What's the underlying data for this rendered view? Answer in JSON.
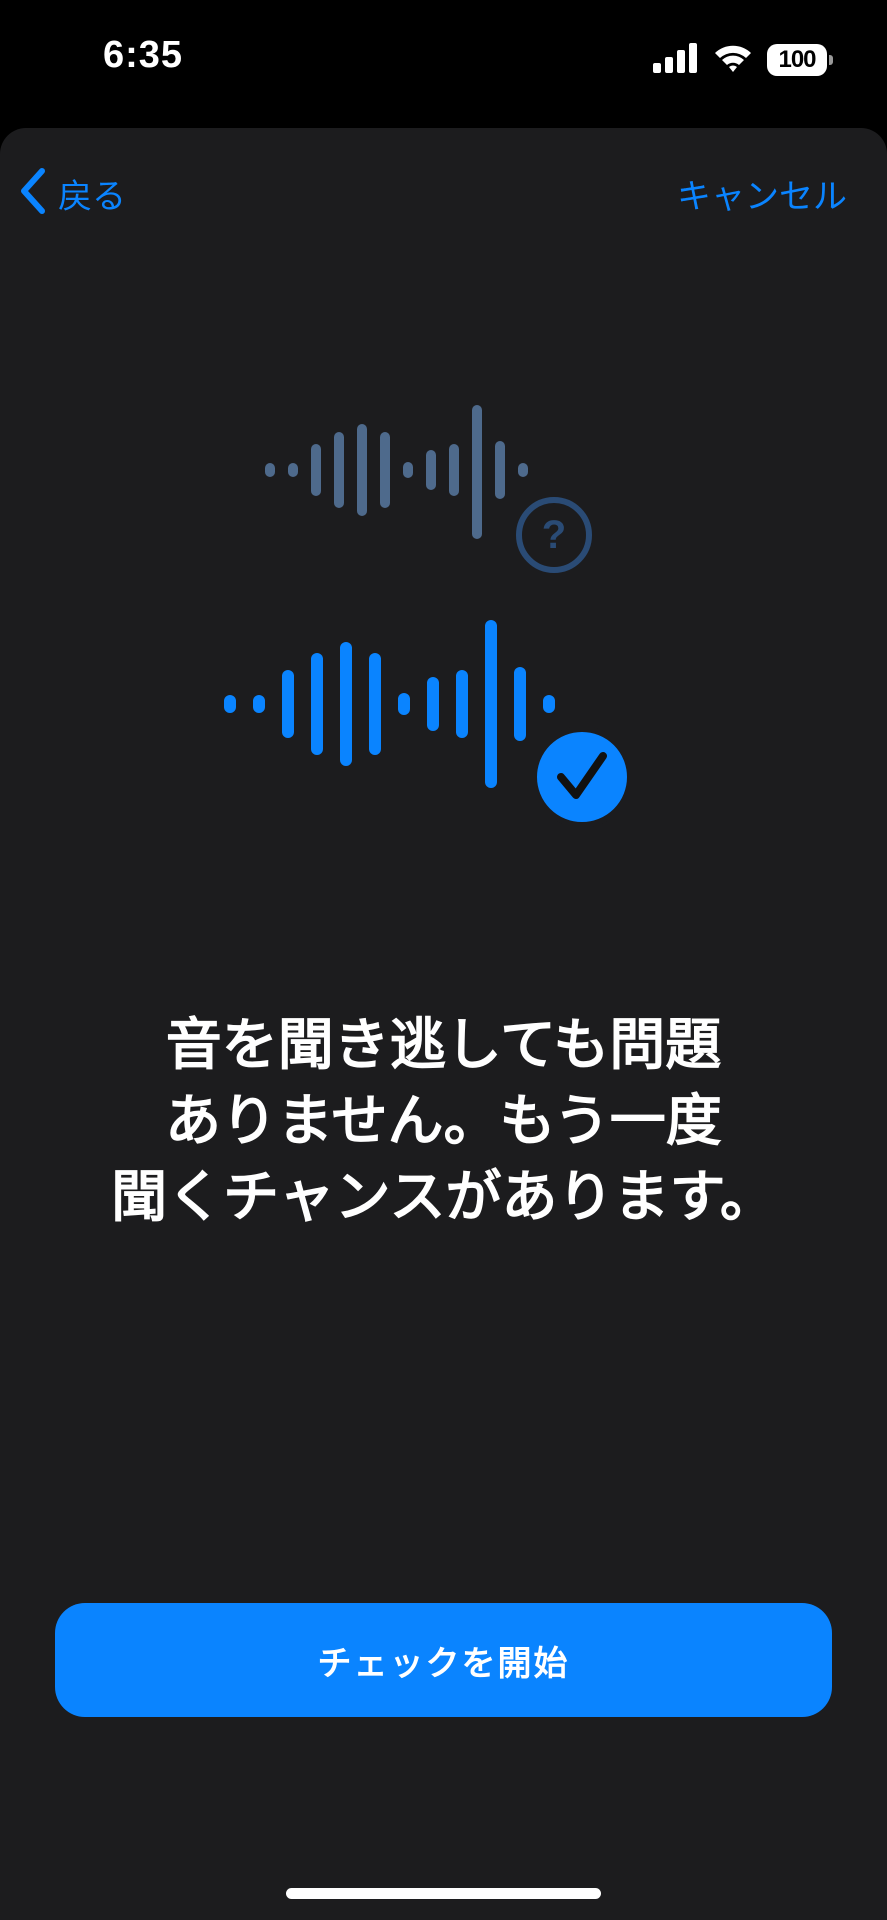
{
  "status_bar": {
    "time": "6:35",
    "battery_level": "100",
    "signal_icon": "cellular-signal-icon",
    "wifi_icon": "wifi-icon"
  },
  "nav": {
    "back_label": "戻る",
    "back_icon": "chevron-left-icon",
    "cancel_label": "キャンセル"
  },
  "illustration": {
    "upper_badge_icon": "question-mark-icon",
    "lower_badge_icon": "checkmark-icon",
    "upper_color": "#4e6a8c",
    "lower_color": "#0a84ff"
  },
  "headline": "音を聞き逃しても問題\nありません。もう一度\n聞くチャンスがあります。",
  "cta_label": "チェックを開始",
  "colors": {
    "accent": "#0a84ff",
    "background": "#1c1c1e",
    "status_bar_bg": "#000000"
  }
}
